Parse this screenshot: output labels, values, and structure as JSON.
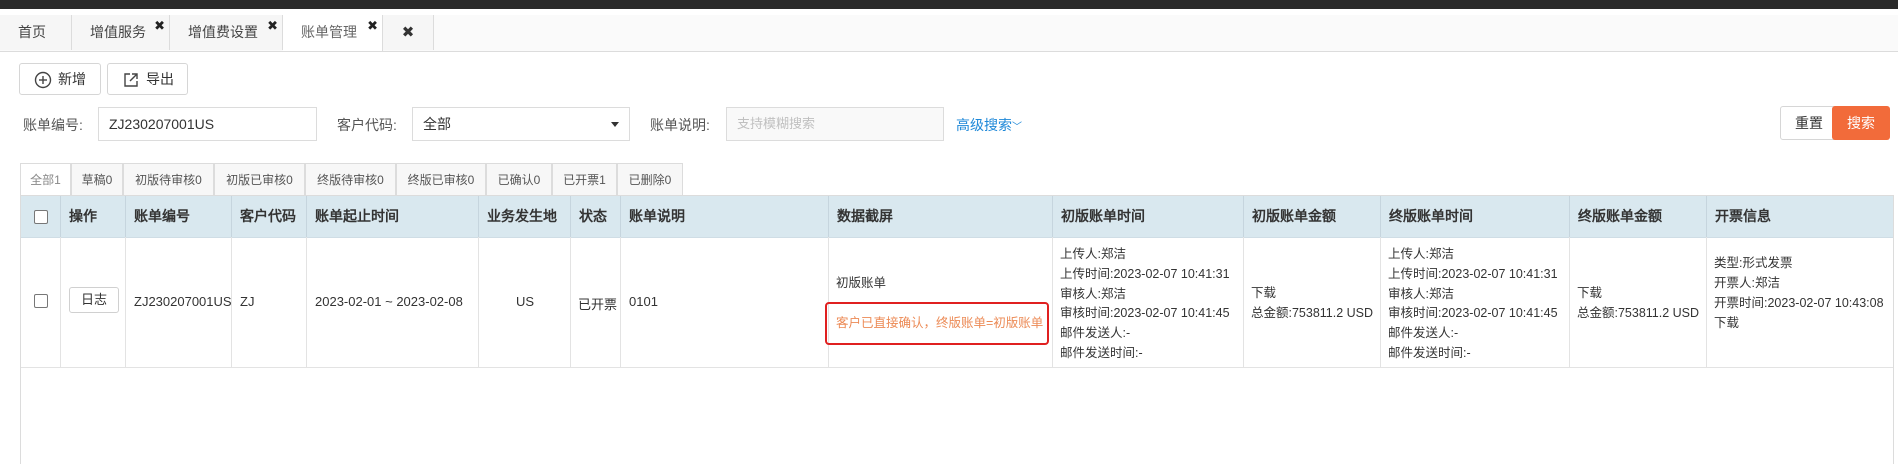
{
  "tabs": [
    {
      "label": "首页",
      "closable": false
    },
    {
      "label": "增值服务",
      "closable": true
    },
    {
      "label": "增值费设置",
      "closable": true
    },
    {
      "label": "账单管理",
      "closable": true,
      "active": true
    }
  ],
  "tab_close_all": "✖",
  "toolbar": {
    "add_label": "新增",
    "export_label": "导出"
  },
  "filters": {
    "bill_no_label": "账单编号:",
    "bill_no_value": "ZJ230207001US",
    "customer_code_label": "客户代码:",
    "customer_code_value": "全部",
    "bill_desc_label": "账单说明:",
    "bill_desc_placeholder": "支持模糊搜索",
    "advanced_search": "高级搜索",
    "reset_label": "重置",
    "search_label": "搜索"
  },
  "status_tabs": [
    "全部1",
    "草稿0",
    "初版待审核0",
    "初版已审核0",
    "终版待审核0",
    "终版已审核0",
    "已确认0",
    "已开票1",
    "已删除0"
  ],
  "table": {
    "headers": [
      "操作",
      "账单编号",
      "客户代码",
      "账单起止时间",
      "业务发生地",
      "状态",
      "账单说明",
      "数据截屏",
      "初版账单时间",
      "初版账单金额",
      "终版账单时间",
      "终版账单金额",
      "开票信息"
    ],
    "row": {
      "action_label": "日志",
      "bill_no": "ZJ230207001US",
      "customer_code": "ZJ",
      "period": "2023-02-01 ~ 2023-02-08",
      "location": "US",
      "status": "已开票",
      "description": "0101",
      "screenshot_link": "初版账单",
      "screenshot_note": "客户已直接确认，终版账单=初版账单",
      "initial_time_lines": [
        "上传人:郑洁",
        "上传时间:2023-02-07 10:41:31",
        "审核人:郑洁",
        "审核时间:2023-02-07 10:41:45",
        "邮件发送人:-",
        "邮件发送时间:-"
      ],
      "initial_amount_link": "下载",
      "initial_amount_total": "总金额:753811.2 USD",
      "final_time_lines": [
        "上传人:郑洁",
        "上传时间:2023-02-07 10:41:31",
        "审核人:郑洁",
        "审核时间:2023-02-07 10:41:45",
        "邮件发送人:-",
        "邮件发送时间:-"
      ],
      "final_amount_link": "下载",
      "final_amount_total": "总金额:753811.2 USD",
      "invoice_lines": [
        "类型:形式发票",
        "开票人:郑洁",
        "开票时间:2023-02-07 10:43:08"
      ],
      "invoice_link": "下载"
    }
  },
  "colors": {
    "accent_orange": "#f26b3a",
    "link_blue": "#1e88d8",
    "header_bg": "#d9e8ef",
    "highlight_red": "#e02020"
  }
}
